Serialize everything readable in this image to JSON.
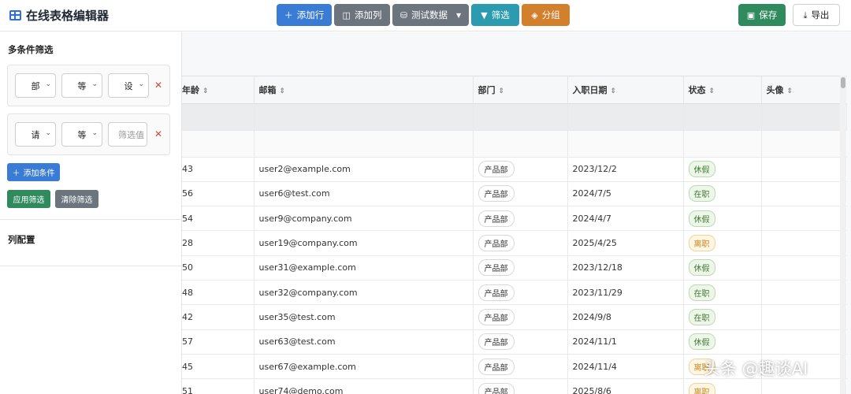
{
  "app": {
    "title": "在线表格编辑器",
    "icon": "table-icon"
  },
  "toolbar": {
    "add_row": "添加行",
    "add_col": "添加列",
    "test_data": "测试数据",
    "filter": "筛选",
    "group": "分组",
    "save": "保存",
    "export": "导出"
  },
  "sidebar": {
    "filter_title": "多条件筛选",
    "conditions": [
      {
        "field": "部",
        "operator": "等",
        "value": "设",
        "value_placeholder": ""
      },
      {
        "field": "请",
        "operator": "等",
        "value": "",
        "value_placeholder": "筛选值"
      }
    ],
    "add_condition": "添加条件",
    "apply": "应用筛选",
    "clear": "清除筛选",
    "column_config_title": "列配置"
  },
  "table": {
    "columns": [
      "年龄",
      "邮箱",
      "部门",
      "入职日期",
      "状态",
      "头像"
    ],
    "rows": [
      {
        "age": "43",
        "email": "user2@example.com",
        "dept": "产品部",
        "date": "2023/12/2",
        "status": "休假",
        "status_type": "leave"
      },
      {
        "age": "56",
        "email": "user6@test.com",
        "dept": "产品部",
        "date": "2024/7/5",
        "status": "在职",
        "status_type": "on"
      },
      {
        "age": "54",
        "email": "user9@company.com",
        "dept": "产品部",
        "date": "2024/4/7",
        "status": "休假",
        "status_type": "leave"
      },
      {
        "age": "28",
        "email": "user19@company.com",
        "dept": "产品部",
        "date": "2025/4/25",
        "status": "离职",
        "status_type": "quit"
      },
      {
        "age": "50",
        "email": "user31@example.com",
        "dept": "产品部",
        "date": "2023/12/18",
        "status": "休假",
        "status_type": "leave"
      },
      {
        "age": "48",
        "email": "user32@company.com",
        "dept": "产品部",
        "date": "2023/11/29",
        "status": "在职",
        "status_type": "on"
      },
      {
        "age": "42",
        "email": "user35@test.com",
        "dept": "产品部",
        "date": "2024/9/8",
        "status": "在职",
        "status_type": "on"
      },
      {
        "age": "57",
        "email": "user63@test.com",
        "dept": "产品部",
        "date": "2024/11/1",
        "status": "休假",
        "status_type": "leave"
      },
      {
        "age": "45",
        "email": "user67@example.com",
        "dept": "产品部",
        "date": "2024/11/4",
        "status": "离职",
        "status_type": "quit"
      },
      {
        "age": "51",
        "email": "user74@demo.com",
        "dept": "产品部",
        "date": "2025/8/6",
        "status": "离职",
        "status_type": "quit"
      }
    ]
  },
  "watermark": "头条 @趣谈AI"
}
